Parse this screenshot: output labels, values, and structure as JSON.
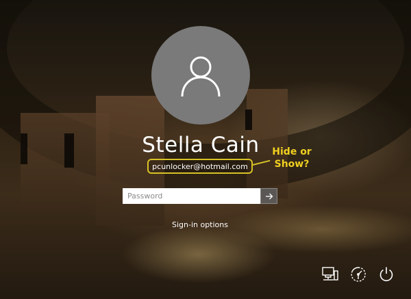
{
  "user": {
    "name": "Stella Cain",
    "email": "pcunlocker@hotmail.com"
  },
  "annotation": {
    "callout_line1": "Hide or",
    "callout_line2": "Show?",
    "highlight_color": "#d8c326",
    "callout_color": "#f0d020"
  },
  "password": {
    "placeholder": "Password",
    "value": "",
    "submit_icon": "arrow-right-icon"
  },
  "signin_options_label": "Sign-in options",
  "system_icons": [
    {
      "name": "network-icon"
    },
    {
      "name": "ease-of-access-icon"
    },
    {
      "name": "power-icon"
    }
  ],
  "avatar": {
    "icon": "user-silhouette-icon",
    "background": "#7a7a7a"
  }
}
